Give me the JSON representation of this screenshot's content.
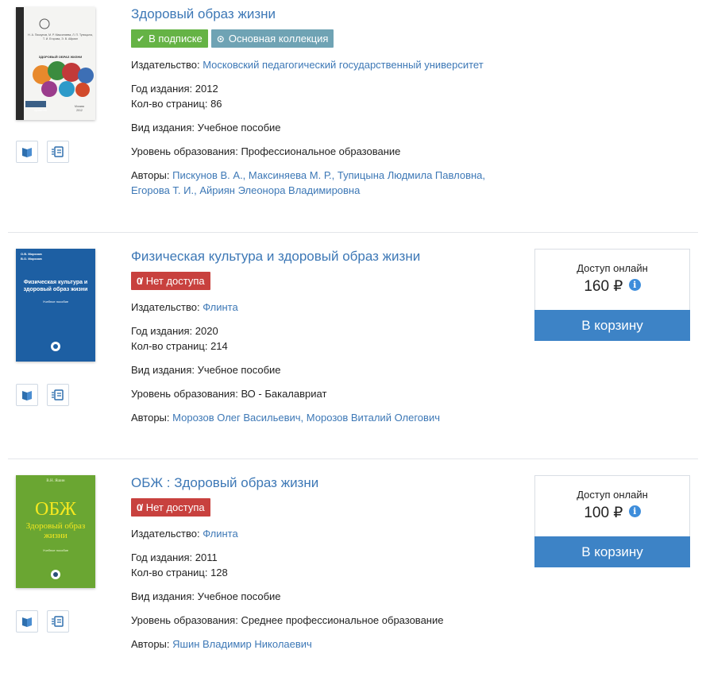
{
  "books": [
    {
      "title": "Здоровый образ жизни",
      "badges": [
        "В подписке",
        "Основная коллекция"
      ],
      "publisher_label": "Издательство:",
      "publisher": "Московский педагогический государственный университет",
      "year_label": "Год издания:",
      "year": "2012",
      "pages_label": "Кол-во страниц:",
      "pages": "86",
      "type_label": "Вид издания:",
      "type": "Учебное пособие",
      "level_label": "Уровень образования:",
      "level": "Профессиональное образование",
      "authors_label": "Авторы:",
      "authors": [
        "Пискунов В. А.,",
        "Максиняева М. Р.,",
        "Тупицына Людмила Павловна,",
        "Егорова Т. И.,",
        "Айриян Элеонора Владимировна"
      ],
      "cover": {
        "title": "ЗДОРОВЫЙ ОБРАЗ ЖИЗНИ",
        "city": "Москва",
        "year": "2012",
        "publisher": "прометей",
        "authors": "Н. А. Пискунов, М. Р. Максиняева, Л. П. Тупицына, Т. И. Егорова, Э. В. Айриян"
      }
    },
    {
      "title": "Физическая культура и здоровый образ жизни",
      "badges": [
        "Нет доступа"
      ],
      "publisher_label": "Издательство:",
      "publisher": "Флинта",
      "year_label": "Год издания:",
      "year": "2020",
      "pages_label": "Кол-во страниц:",
      "pages": "214",
      "type_label": "Вид издания:",
      "type": "Учебное пособие",
      "level_label": "Уровень образования:",
      "level": "ВО - Бакалавриат",
      "authors_label": "Авторы:",
      "authors": [
        "Морозов Олег Васильевич,",
        "Морозов Виталий Олегович"
      ],
      "access_label": "Доступ онлайн",
      "price": "160 ₽",
      "cart_label": "В корзину",
      "cover": {
        "authors": [
          "О.В. Морозов",
          "В.О. Морозов"
        ],
        "title": "Физическая культура и здоровый образ жизни",
        "subtitle": "Учебное пособие"
      }
    },
    {
      "title": "ОБЖ : Здоровый образ жизни",
      "badges": [
        "Нет доступа"
      ],
      "publisher_label": "Издательство:",
      "publisher": "Флинта",
      "year_label": "Год издания:",
      "year": "2011",
      "pages_label": "Кол-во страниц:",
      "pages": "128",
      "type_label": "Вид издания:",
      "type": "Учебное пособие",
      "level_label": "Уровень образования:",
      "level": "Среднее профессиональное образование",
      "authors_label": "Авторы:",
      "authors": [
        "Яшин Владимир Николаевич"
      ],
      "access_label": "Доступ онлайн",
      "price": "100 ₽",
      "cart_label": "В корзину",
      "cover": {
        "author": "В.Н. Яшин",
        "title": "ОБЖ",
        "subtitle": "Здоровый образ жизни",
        "kind": "Учебное пособие"
      }
    }
  ],
  "icons": {
    "read": "book-read-icon",
    "cite": "bibliography-icon",
    "check": "check-icon",
    "collection": "collection-icon",
    "no_access": "no-access-icon",
    "info": "info-icon"
  },
  "colors": {
    "link": "#3d78b6",
    "subscription": "#65b345",
    "collection": "#6fa3b4",
    "no_access": "#c8413e",
    "cart": "#3d83c6"
  }
}
